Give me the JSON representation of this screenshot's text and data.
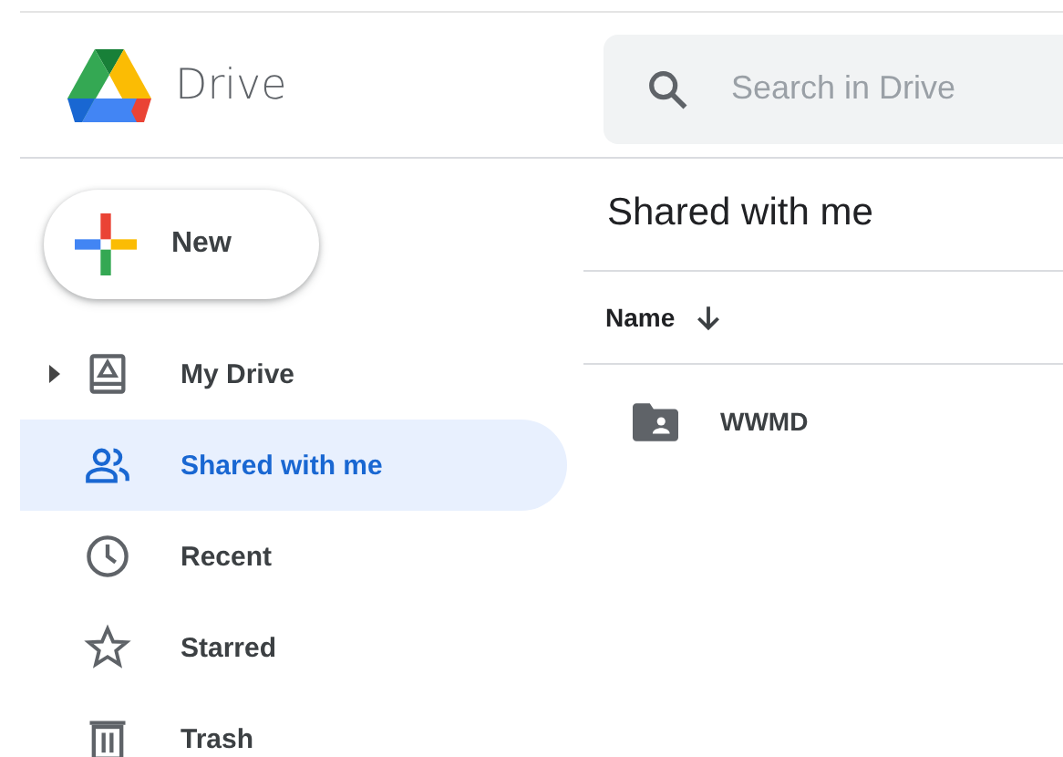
{
  "app": {
    "name": "Drive"
  },
  "search": {
    "placeholder": "Search in Drive"
  },
  "new_button": {
    "label": "New"
  },
  "sidebar": {
    "items": [
      {
        "kind": "my-drive",
        "label": "My Drive",
        "selected": false,
        "expandable": true
      },
      {
        "kind": "shared",
        "label": "Shared with me",
        "selected": true,
        "expandable": false
      },
      {
        "kind": "recent",
        "label": "Recent",
        "selected": false,
        "expandable": false
      },
      {
        "kind": "starred",
        "label": "Starred",
        "selected": false,
        "expandable": false
      },
      {
        "kind": "trash",
        "label": "Trash",
        "selected": false,
        "expandable": false
      }
    ]
  },
  "main": {
    "title": "Shared with me",
    "table": {
      "columns": [
        {
          "label": "Name",
          "sort_descending": true
        }
      ],
      "rows": [
        {
          "kind": "shared-folder",
          "name": "WWMD"
        }
      ]
    }
  }
}
